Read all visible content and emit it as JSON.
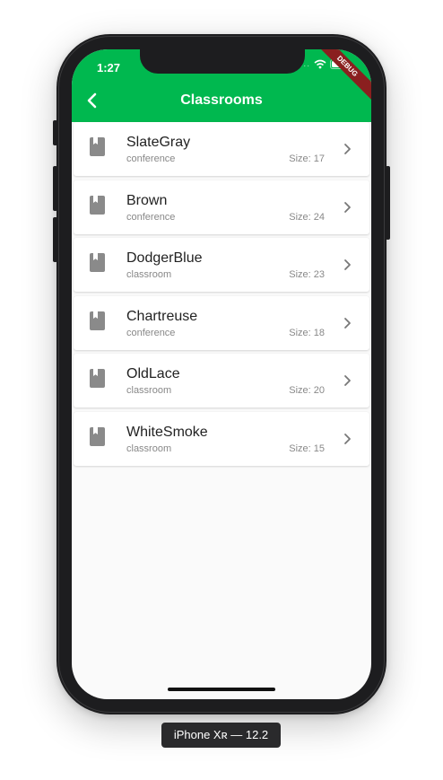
{
  "status": {
    "time": "1:27",
    "signal_dots": "....",
    "debug_label": "DEBUG"
  },
  "appbar": {
    "title": "Classrooms",
    "back_icon": "chevron-left-icon"
  },
  "classrooms": [
    {
      "name": "SlateGray",
      "type": "conference",
      "size": "Size: 17"
    },
    {
      "name": "Brown",
      "type": "conference",
      "size": "Size: 24"
    },
    {
      "name": "DodgerBlue",
      "type": "classroom",
      "size": "Size: 23"
    },
    {
      "name": "Chartreuse",
      "type": "conference",
      "size": "Size: 18"
    },
    {
      "name": "OldLace",
      "type": "classroom",
      "size": "Size: 20"
    },
    {
      "name": "WhiteSmoke",
      "type": "classroom",
      "size": "Size: 15"
    }
  ],
  "device": {
    "label": "iPhone Xʀ — 12.2"
  },
  "colors": {
    "accent": "#00b84f",
    "debug": "#8a1f1f"
  },
  "icons": {
    "row_leading": "book-icon",
    "row_trailing": "chevron-right-icon",
    "status": [
      "wifi-icon",
      "battery-icon"
    ]
  }
}
